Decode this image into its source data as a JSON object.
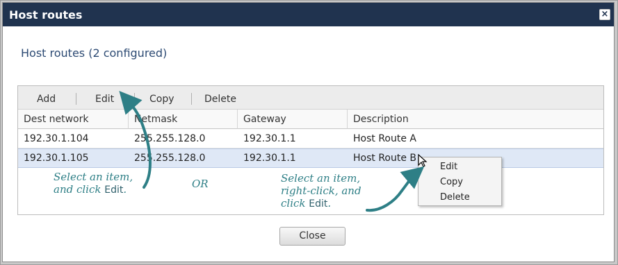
{
  "dialog": {
    "title": "Host routes",
    "close_icon": "close-icon",
    "heading": "Host routes (2 configured)"
  },
  "toolbar": {
    "add_label": "Add",
    "edit_label": "Edit",
    "copy_label": "Copy",
    "delete_label": "Delete"
  },
  "table": {
    "columns": [
      "Dest network",
      "Netmask",
      "Gateway",
      "Description"
    ],
    "rows": [
      {
        "dest": "192.30.1.104",
        "netmask": "255.255.128.0",
        "gateway": "192.30.1.1",
        "description": "Host Route A"
      },
      {
        "dest": "192.30.1.105",
        "netmask": "255.255.128.0",
        "gateway": "192.30.1.1",
        "description": "Host Route B"
      }
    ],
    "selected_row": 2
  },
  "context_menu": {
    "items": [
      "Edit",
      "Copy",
      "Delete"
    ]
  },
  "footer": {
    "close_label": "Close"
  },
  "annotations": {
    "left_note": {
      "line1": "Select an item,",
      "line2_prefix": "and click ",
      "keyword": "Edit",
      "line2_suffix": "."
    },
    "or_text": "OR",
    "right_note": {
      "line1": "Select an item,",
      "line2": "right-click, and",
      "line3_prefix": "click ",
      "keyword": "Edit",
      "line3_suffix": "."
    }
  },
  "colors": {
    "titlebar": "#20334f",
    "heading": "#2c4a73",
    "selected_row": "#dfe8f6",
    "annotation": "#2e7f86"
  }
}
